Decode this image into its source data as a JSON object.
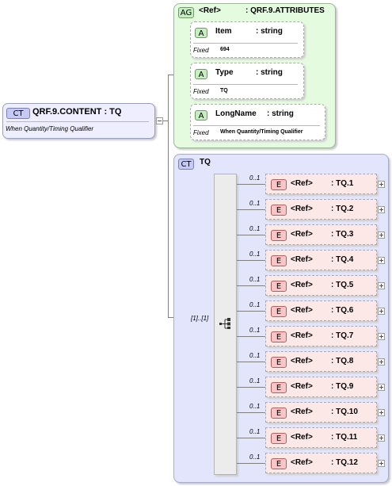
{
  "root": {
    "badge": "CT",
    "name": "QRF.9.CONTENT : TQ",
    "documentation": "When Quantity/Timing Qualifier"
  },
  "attribute_group": {
    "badge": "AG",
    "ref_label": "<Ref>",
    "name": ": QRF.9.ATTRIBUTES",
    "attributes": [
      {
        "badge": "A",
        "name": "Item",
        "type": ": string",
        "fixed_label": "Fixed",
        "fixed_value": "694"
      },
      {
        "badge": "A",
        "name": "Type",
        "type": ": string",
        "fixed_label": "Fixed",
        "fixed_value": "TQ"
      },
      {
        "badge": "A",
        "name": "LongName",
        "type": ": string",
        "fixed_label": "Fixed",
        "fixed_value": "When Quantity/Timing Qualifier"
      }
    ]
  },
  "complex_type": {
    "badge": "CT",
    "name": "TQ",
    "sequence_cardinality": "[1]..[1]",
    "elements": [
      {
        "cardinality": "0..1",
        "badge": "E",
        "ref_label": "<Ref>",
        "name": ": TQ.1"
      },
      {
        "cardinality": "0..1",
        "badge": "E",
        "ref_label": "<Ref>",
        "name": ": TQ.2"
      },
      {
        "cardinality": "0..1",
        "badge": "E",
        "ref_label": "<Ref>",
        "name": ": TQ.3"
      },
      {
        "cardinality": "0..1",
        "badge": "E",
        "ref_label": "<Ref>",
        "name": ": TQ.4"
      },
      {
        "cardinality": "0..1",
        "badge": "E",
        "ref_label": "<Ref>",
        "name": ": TQ.5"
      },
      {
        "cardinality": "0..1",
        "badge": "E",
        "ref_label": "<Ref>",
        "name": ": TQ.6"
      },
      {
        "cardinality": "0..1",
        "badge": "E",
        "ref_label": "<Ref>",
        "name": ": TQ.7"
      },
      {
        "cardinality": "0..1",
        "badge": "E",
        "ref_label": "<Ref>",
        "name": ": TQ.8"
      },
      {
        "cardinality": "0..1",
        "badge": "E",
        "ref_label": "<Ref>",
        "name": ": TQ.9"
      },
      {
        "cardinality": "0..1",
        "badge": "E",
        "ref_label": "<Ref>",
        "name": ": TQ.10"
      },
      {
        "cardinality": "0..1",
        "badge": "E",
        "ref_label": "<Ref>",
        "name": ": TQ.11"
      },
      {
        "cardinality": "0..1",
        "badge": "E",
        "ref_label": "<Ref>",
        "name": ": TQ.12"
      }
    ]
  },
  "colors": {
    "root_fill": "#eeeeff",
    "attribute_group_fill": "#e4fbe0",
    "complex_type_fill": "#e3e5fd",
    "element_fill": "#fde8e8",
    "element_badge": "#f7c6c6",
    "attribute_badge": "#c6eec0",
    "ct_badge": "#c5c9f5"
  },
  "icons": {
    "sequence": "sequence-compositor-icon",
    "expand": "plus-icon",
    "collapse": "minus-icon"
  }
}
